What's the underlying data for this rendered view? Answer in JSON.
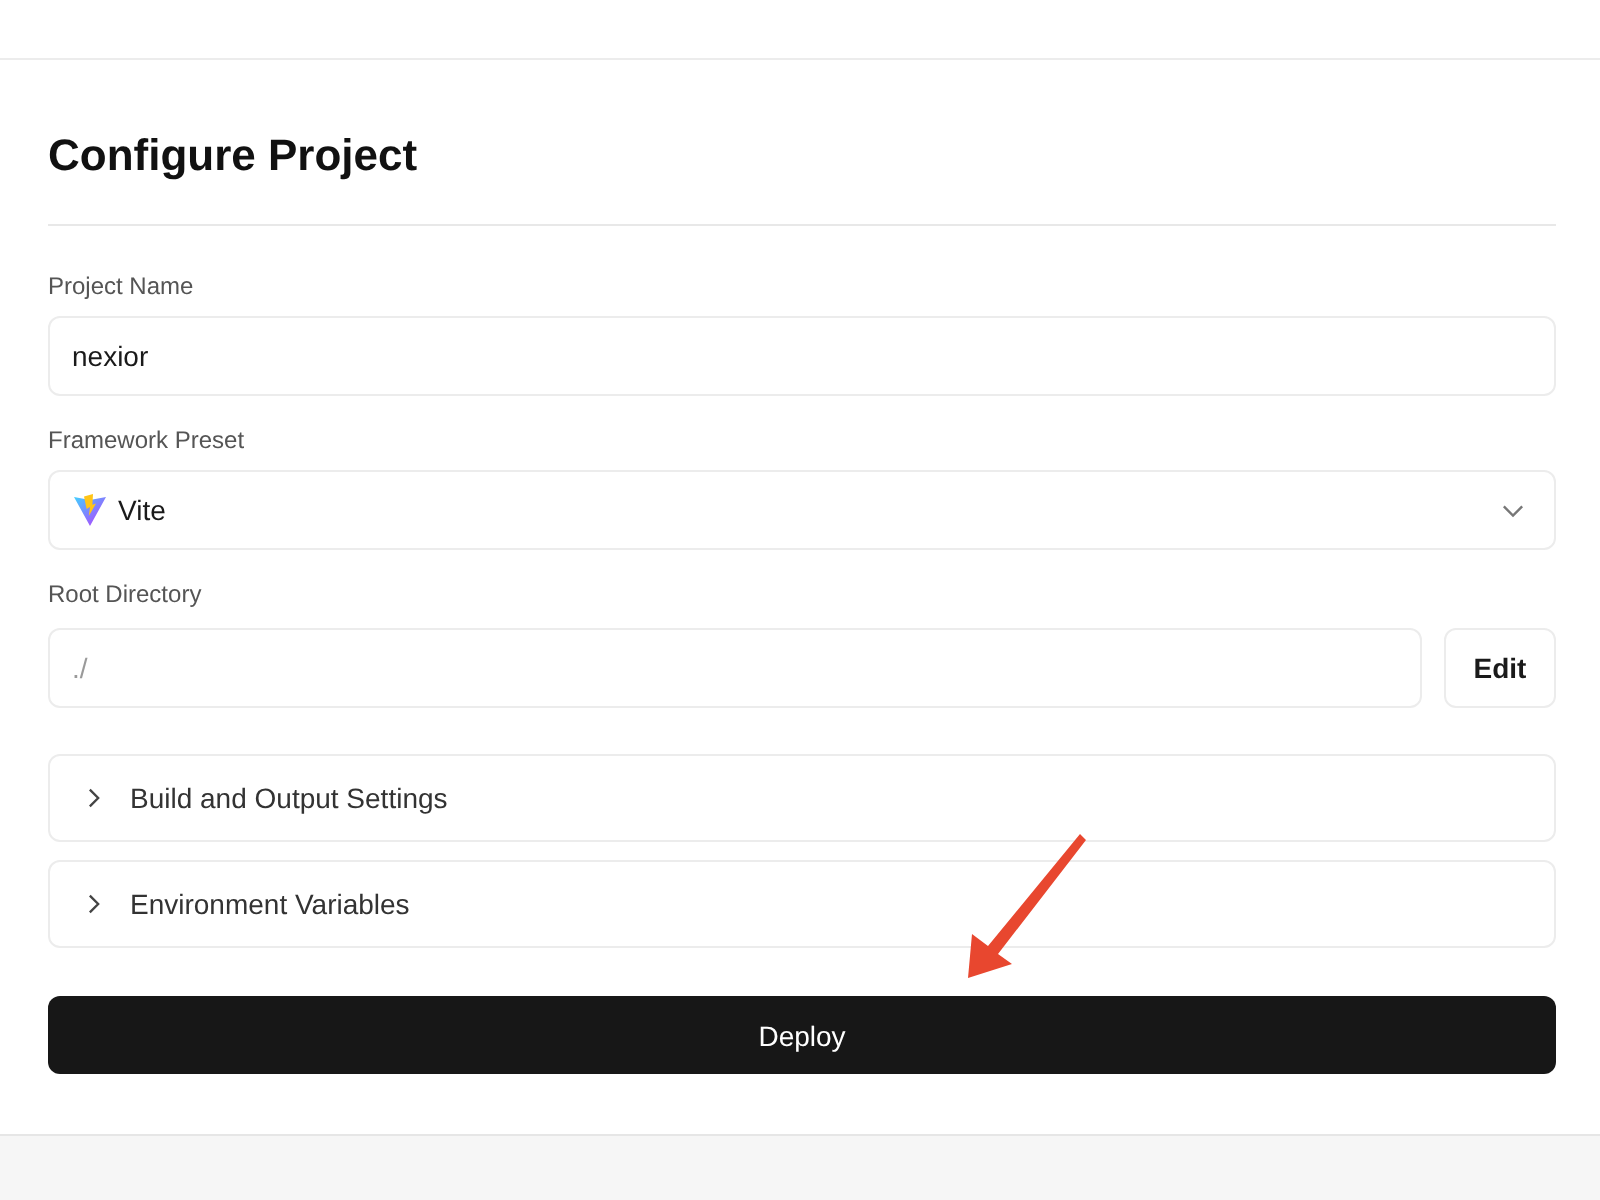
{
  "page": {
    "title": "Configure Project"
  },
  "fields": [
    {
      "kind": "input",
      "label": "Project Name",
      "value": "nexior"
    },
    {
      "kind": "select",
      "label": "Framework Preset",
      "value": "Vite"
    },
    {
      "kind": "input_button",
      "label": "Root Directory",
      "placeholder": "./",
      "button": "Edit"
    }
  ],
  "sections": [
    {
      "label": "Build and Output Settings",
      "expanded": false
    },
    {
      "label": "Environment Variables",
      "expanded": false
    }
  ],
  "primary_button": "Deploy"
}
